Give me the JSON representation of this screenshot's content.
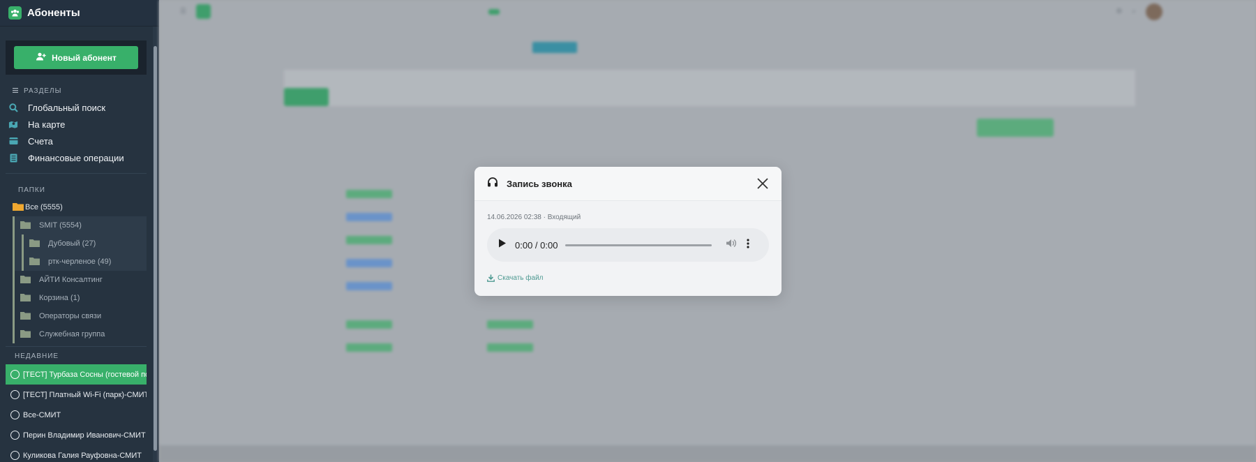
{
  "sidebar": {
    "title": "Абоненты",
    "new_button": "Новый абонент",
    "sections_label": "РАЗДЕЛЫ",
    "nav": [
      {
        "label": "Глобальный поиск",
        "icon": "search-icon"
      },
      {
        "label": "На карте",
        "icon": "map-icon"
      },
      {
        "label": "Счета",
        "icon": "wallet-icon"
      },
      {
        "label": "Финансовые операции",
        "icon": "receipt-icon"
      }
    ],
    "folders_label": "ПАПКИ",
    "folder_root": "Все (5555)",
    "folders": [
      {
        "label": "SMIT (5554)",
        "level": 1
      },
      {
        "label": "Дубовый (27)",
        "level": 2
      },
      {
        "label": "ртк-черленое (49)",
        "level": 2
      },
      {
        "label": "АЙТИ Консалтинг",
        "level": 1
      },
      {
        "label": "Корзина (1)",
        "level": 1
      },
      {
        "label": "Операторы связи",
        "level": 1
      },
      {
        "label": "Служебная группа",
        "level": 1
      }
    ],
    "recent_label": "НЕДАВНИЕ",
    "recent": [
      {
        "label": "[ТЕСТ] Турбаза Сосны (гостевой портал)",
        "active": true
      },
      {
        "label": "[ТЕСТ] Платный Wi-Fi (парк)-СМИТ",
        "active": false
      },
      {
        "label": "Все-СМИТ",
        "active": false
      },
      {
        "label": "Перин Владимир Иванович-СМИТ",
        "active": false
      },
      {
        "label": "Куликова Галия Рауфовна-СМИТ",
        "active": false
      }
    ]
  },
  "modal": {
    "title": "Запись звонка",
    "meta": "14.06.2026 02:38 · Входящий",
    "player_time": "0:00 / 0:00",
    "download_label": "Скачать файл"
  },
  "colors": {
    "accent": "#38b06a",
    "sidebar_bg": "#263340",
    "link": "#4f9a92"
  }
}
